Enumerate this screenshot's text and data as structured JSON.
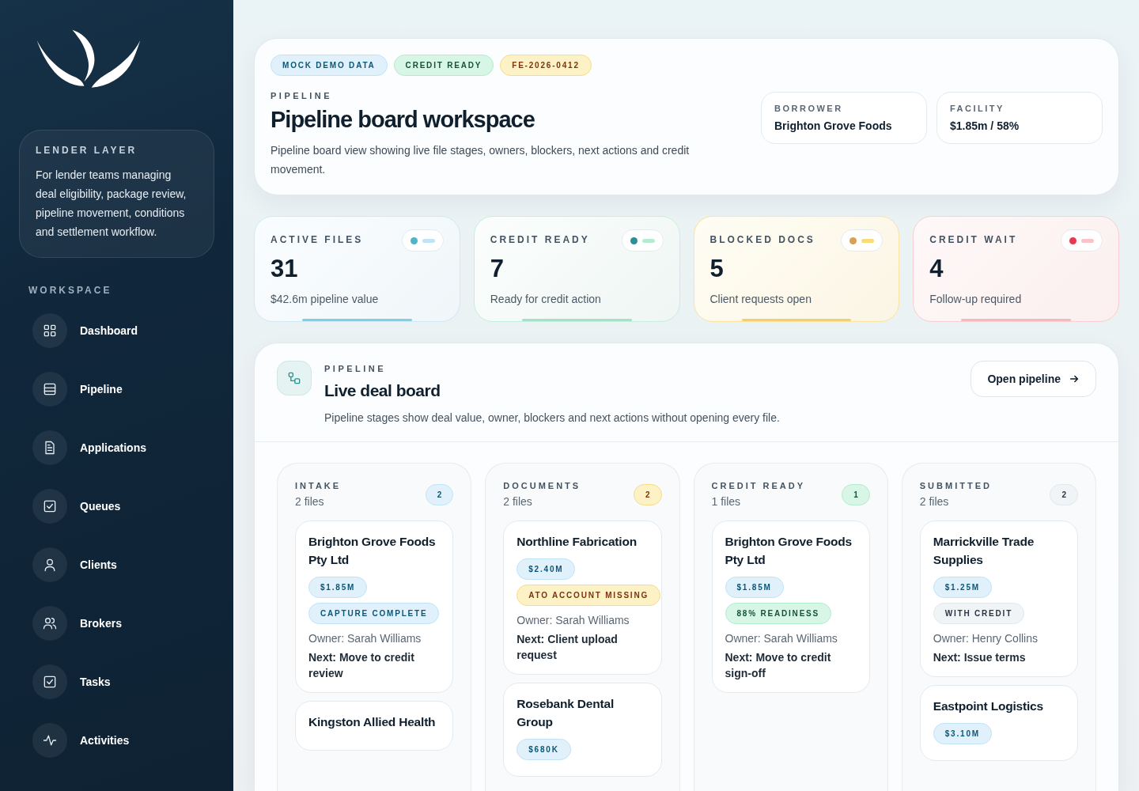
{
  "sidebar": {
    "brand_card": {
      "title": "LENDER LAYER",
      "text": "For lender teams managing deal eligibility, package review, pipeline movement, conditions and settlement workflow."
    },
    "section_label": "WORKSPACE",
    "items": [
      {
        "label": "Dashboard",
        "kind": "grid"
      },
      {
        "label": "Pipeline",
        "kind": "list"
      },
      {
        "label": "Applications",
        "kind": "doc"
      },
      {
        "label": "Queues",
        "kind": "check"
      },
      {
        "label": "Clients",
        "kind": "user"
      },
      {
        "label": "Brokers",
        "kind": "users"
      },
      {
        "label": "Tasks",
        "kind": "check"
      },
      {
        "label": "Activities",
        "kind": "pulse"
      }
    ]
  },
  "header": {
    "tags": [
      {
        "label": "MOCK DEMO DATA",
        "kind": "info"
      },
      {
        "label": "CREDIT READY",
        "kind": "success"
      },
      {
        "label": "FE-2026-0412",
        "kind": "warning"
      }
    ],
    "eyebrow": "PIPELINE",
    "title": "Pipeline board workspace",
    "description": "Pipeline board view showing live file stages, owners, blockers, next actions and credit movement.",
    "facts": [
      {
        "label": "BORROWER",
        "value": "Brighton Grove Foods"
      },
      {
        "label": "FACILITY",
        "value": "$1.85m / 58%"
      }
    ]
  },
  "stats": [
    {
      "label": "ACTIVE FILES",
      "value": "31",
      "caption": "$42.6m pipeline value",
      "kind": "info"
    },
    {
      "label": "CREDIT READY",
      "value": "7",
      "caption": "Ready for credit action",
      "kind": "success"
    },
    {
      "label": "BLOCKED DOCS",
      "value": "5",
      "caption": "Client requests open",
      "kind": "warning"
    },
    {
      "label": "CREDIT WAIT",
      "value": "4",
      "caption": "Follow-up required",
      "kind": "danger"
    }
  ],
  "board": {
    "eyebrow": "PIPELINE",
    "title": "Live deal board",
    "description": "Pipeline stages show deal value, owner, blockers and next actions without opening every file.",
    "action": "Open pipeline",
    "columns": [
      {
        "title": "INTAKE",
        "subtitle": "2 files",
        "count": "2",
        "kind": "info",
        "cards": [
          {
            "name": "Brighton Grove Foods Pty Ltd",
            "tags": [
              {
                "label": "$1.85M",
                "kind": "info"
              },
              {
                "label": "CAPTURE COMPLETE",
                "kind": "info"
              }
            ],
            "owner": "Owner: Sarah Williams",
            "next": "Next: Move to credit review"
          },
          {
            "name": "Kingston Allied Health"
          }
        ]
      },
      {
        "title": "DOCUMENTS",
        "subtitle": "2 files",
        "count": "2",
        "kind": "warning",
        "cards": [
          {
            "name": "Northline Fabrication",
            "tags": [
              {
                "label": "$2.40M",
                "kind": "info"
              },
              {
                "label": "ATO ACCOUNT MISSING",
                "kind": "warning"
              }
            ],
            "owner": "Owner: Sarah Williams",
            "next": "Next: Client upload request"
          },
          {
            "name": "Rosebank Dental Group",
            "tags": [
              {
                "label": "$680K",
                "kind": "info"
              }
            ]
          }
        ]
      },
      {
        "title": "CREDIT READY",
        "subtitle": "1 files",
        "count": "1",
        "kind": "success",
        "cards": [
          {
            "name": "Brighton Grove Foods Pty Ltd",
            "tags": [
              {
                "label": "$1.85M",
                "kind": "info"
              },
              {
                "label": "88% READINESS",
                "kind": "success"
              }
            ],
            "owner": "Owner: Sarah Williams",
            "next": "Next: Move to credit sign-off"
          }
        ]
      },
      {
        "title": "SUBMITTED",
        "subtitle": "2 files",
        "count": "2",
        "kind": "neutral",
        "cards": [
          {
            "name": "Marrickville Trade Supplies",
            "tags": [
              {
                "label": "$1.25M",
                "kind": "info"
              },
              {
                "label": "WITH CREDIT",
                "kind": "neutral"
              }
            ],
            "owner": "Owner: Henry Collins",
            "next": "Next: Issue terms"
          },
          {
            "name": "Eastpoint Logistics",
            "tags": [
              {
                "label": "$3.10M",
                "kind": "info"
              }
            ]
          }
        ]
      }
    ]
  }
}
